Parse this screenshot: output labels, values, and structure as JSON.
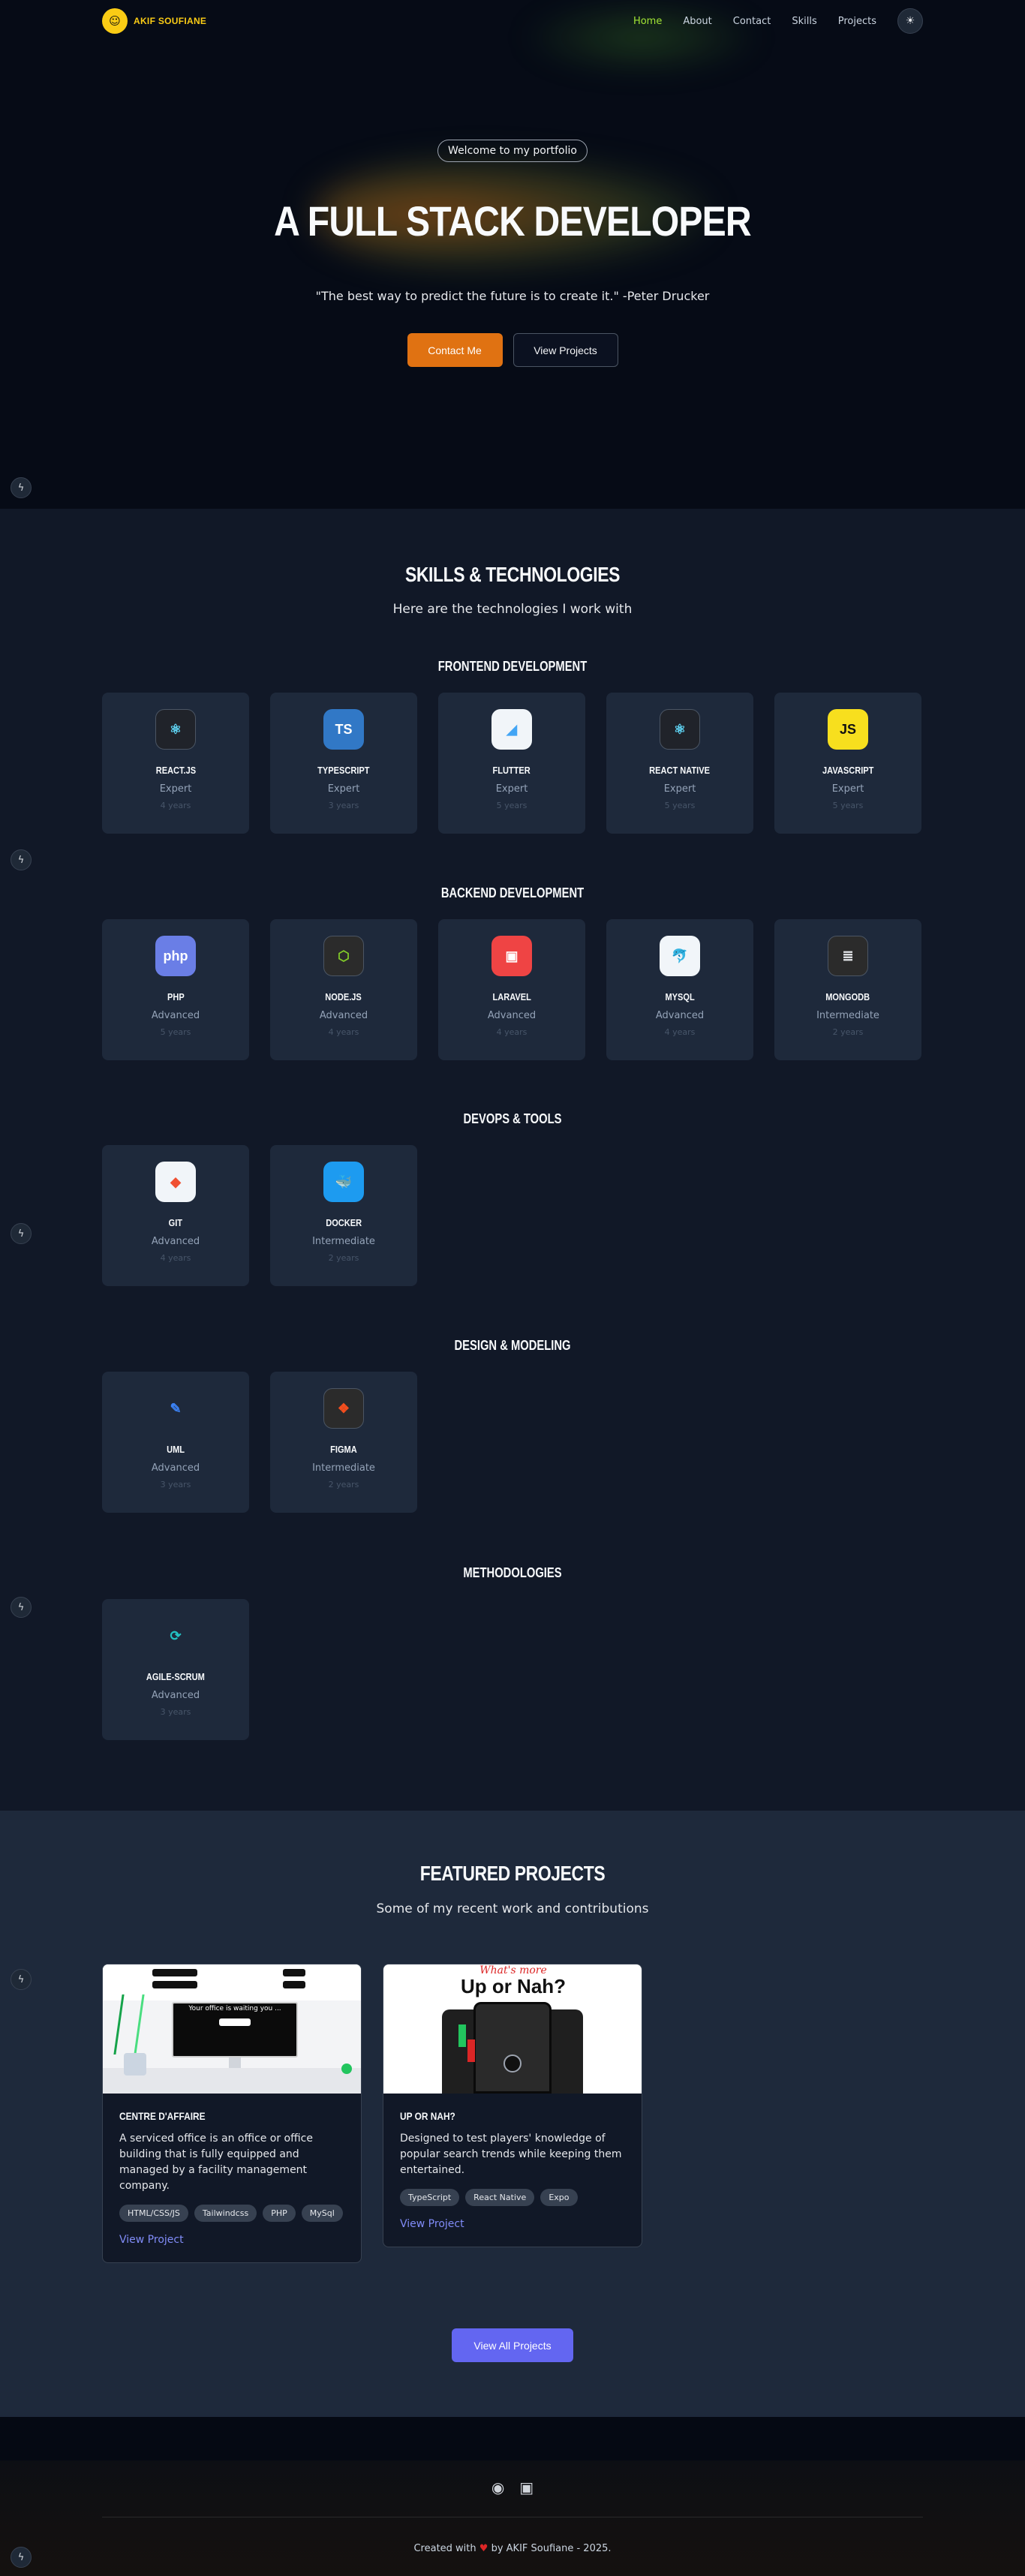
{
  "header": {
    "brand_name": "AKIF SOUFIANE",
    "nav": [
      "Home",
      "About",
      "Contact",
      "Skills",
      "Projects"
    ],
    "active_nav": "Home",
    "theme_icon": "sun-icon",
    "avatar_icon": "avatar-icon"
  },
  "hero": {
    "badge": "Welcome to my portfolio",
    "title": "A FULL STACK DEVELOPER",
    "quote": "\"The best way to predict the future is to create it.\" -Peter Drucker",
    "primary_button": "Contact Me",
    "secondary_button": "View Projects"
  },
  "side_icon": "bolt-icon",
  "skills": {
    "title": "SKILLS & TECHNOLOGIES",
    "subtitle": "Here are the technologies I work with",
    "categories": [
      {
        "title": "FRONTEND DEVELOPMENT",
        "items": [
          {
            "name": "React.js",
            "level": "Expert",
            "years": "4 years",
            "icon": "react-icon",
            "glyph": "⚛",
            "bg": "#20232a",
            "fg": "#61dafb"
          },
          {
            "name": "TypeScript",
            "level": "Expert",
            "years": "3 years",
            "icon": "typescript-icon",
            "glyph": "TS",
            "bg": "#3178c6",
            "fg": "#ffffff"
          },
          {
            "name": "Flutter",
            "level": "Expert",
            "years": "5 years",
            "icon": "flutter-icon",
            "glyph": "◢",
            "bg": "#f1f5f9",
            "fg": "#42a5f5"
          },
          {
            "name": "React Native",
            "level": "Expert",
            "years": "5 years",
            "icon": "react-native-icon",
            "glyph": "⚛",
            "bg": "#20232a",
            "fg": "#61dafb"
          },
          {
            "name": "JavaScript",
            "level": "Expert",
            "years": "5 years",
            "icon": "javascript-icon",
            "glyph": "JS",
            "bg": "#f7df1e",
            "fg": "#111111"
          }
        ]
      },
      {
        "title": "BACKEND DEVELOPMENT",
        "items": [
          {
            "name": "PHP",
            "level": "Advanced",
            "years": "5 years",
            "icon": "php-icon",
            "glyph": "php",
            "bg": "#6a7ee6",
            "fg": "#ffffff"
          },
          {
            "name": "Node.js",
            "level": "Advanced",
            "years": "4 years",
            "icon": "nodejs-icon",
            "glyph": "⬡",
            "bg": "#2b2b2b",
            "fg": "#83cd29"
          },
          {
            "name": "Laravel",
            "level": "Advanced",
            "years": "4 years",
            "icon": "laravel-icon",
            "glyph": "▣",
            "bg": "#ef4444",
            "fg": "#ffffff"
          },
          {
            "name": "MySQL",
            "level": "Advanced",
            "years": "4 years",
            "icon": "mysql-icon",
            "glyph": "🐬",
            "bg": "#f1f5f9",
            "fg": "#00758f"
          },
          {
            "name": "MongoDB",
            "level": "Intermediate",
            "years": "2 years",
            "icon": "mongodb-icon",
            "glyph": "≣",
            "bg": "#2b2b2b",
            "fg": "#e5e7eb"
          }
        ]
      },
      {
        "title": "DEVOPS & TOOLS",
        "items": [
          {
            "name": "Git",
            "level": "Advanced",
            "years": "4 years",
            "icon": "git-icon",
            "glyph": "◆",
            "bg": "#f1f5f9",
            "fg": "#f05032"
          },
          {
            "name": "Docker",
            "level": "Intermediate",
            "years": "2 years",
            "icon": "docker-icon",
            "glyph": "🐳",
            "bg": "#1d9bf0",
            "fg": "#ffffff"
          }
        ]
      },
      {
        "title": "DESIGN & MODELING",
        "items": [
          {
            "name": "UML",
            "level": "Advanced",
            "years": "3 years",
            "icon": "uml-pen-icon",
            "glyph": "✎",
            "bg": "transparent",
            "fg": "#3b82f6"
          },
          {
            "name": "Figma",
            "level": "Intermediate",
            "years": "2 years",
            "icon": "figma-icon",
            "glyph": "❖",
            "bg": "#2b2b2b",
            "fg": "#f24e1e"
          }
        ]
      },
      {
        "title": "METHODOLOGIES",
        "items": [
          {
            "name": "Agile-Scrum",
            "level": "Advanced",
            "years": "3 years",
            "icon": "agile-scrum-icon",
            "glyph": "⟳",
            "bg": "transparent",
            "fg": "#22c1c3"
          }
        ]
      }
    ]
  },
  "projects": {
    "title": "FEATURED PROJECTS",
    "subtitle": "Some of my recent work and contributions",
    "items": [
      {
        "title": "Centre D'Affaire",
        "description": "A serviced office is an office or office building that is fully equipped and managed by a facility management company.",
        "tags": [
          "HTML/CSS/JS",
          "Tailwindcss",
          "PHP",
          "MySql"
        ],
        "link": "View Project",
        "image_caption": "Your office is waiting you ..."
      },
      {
        "title": "Up or Nah?",
        "description": "Designed to test players' knowledge of popular search trends while keeping them entertained.",
        "tags": [
          "TypeScript",
          "React Native",
          "Expo"
        ],
        "link": "View Project",
        "image_caption": "Up or Nah?",
        "image_script": "What's more"
      }
    ],
    "all_button": "View All Projects"
  },
  "footer": {
    "social_icons": [
      "github-icon",
      "linkedin-icon"
    ],
    "credit_prefix": "Created with",
    "credit_suffix": "by AKIF Soufiane - 2025."
  }
}
